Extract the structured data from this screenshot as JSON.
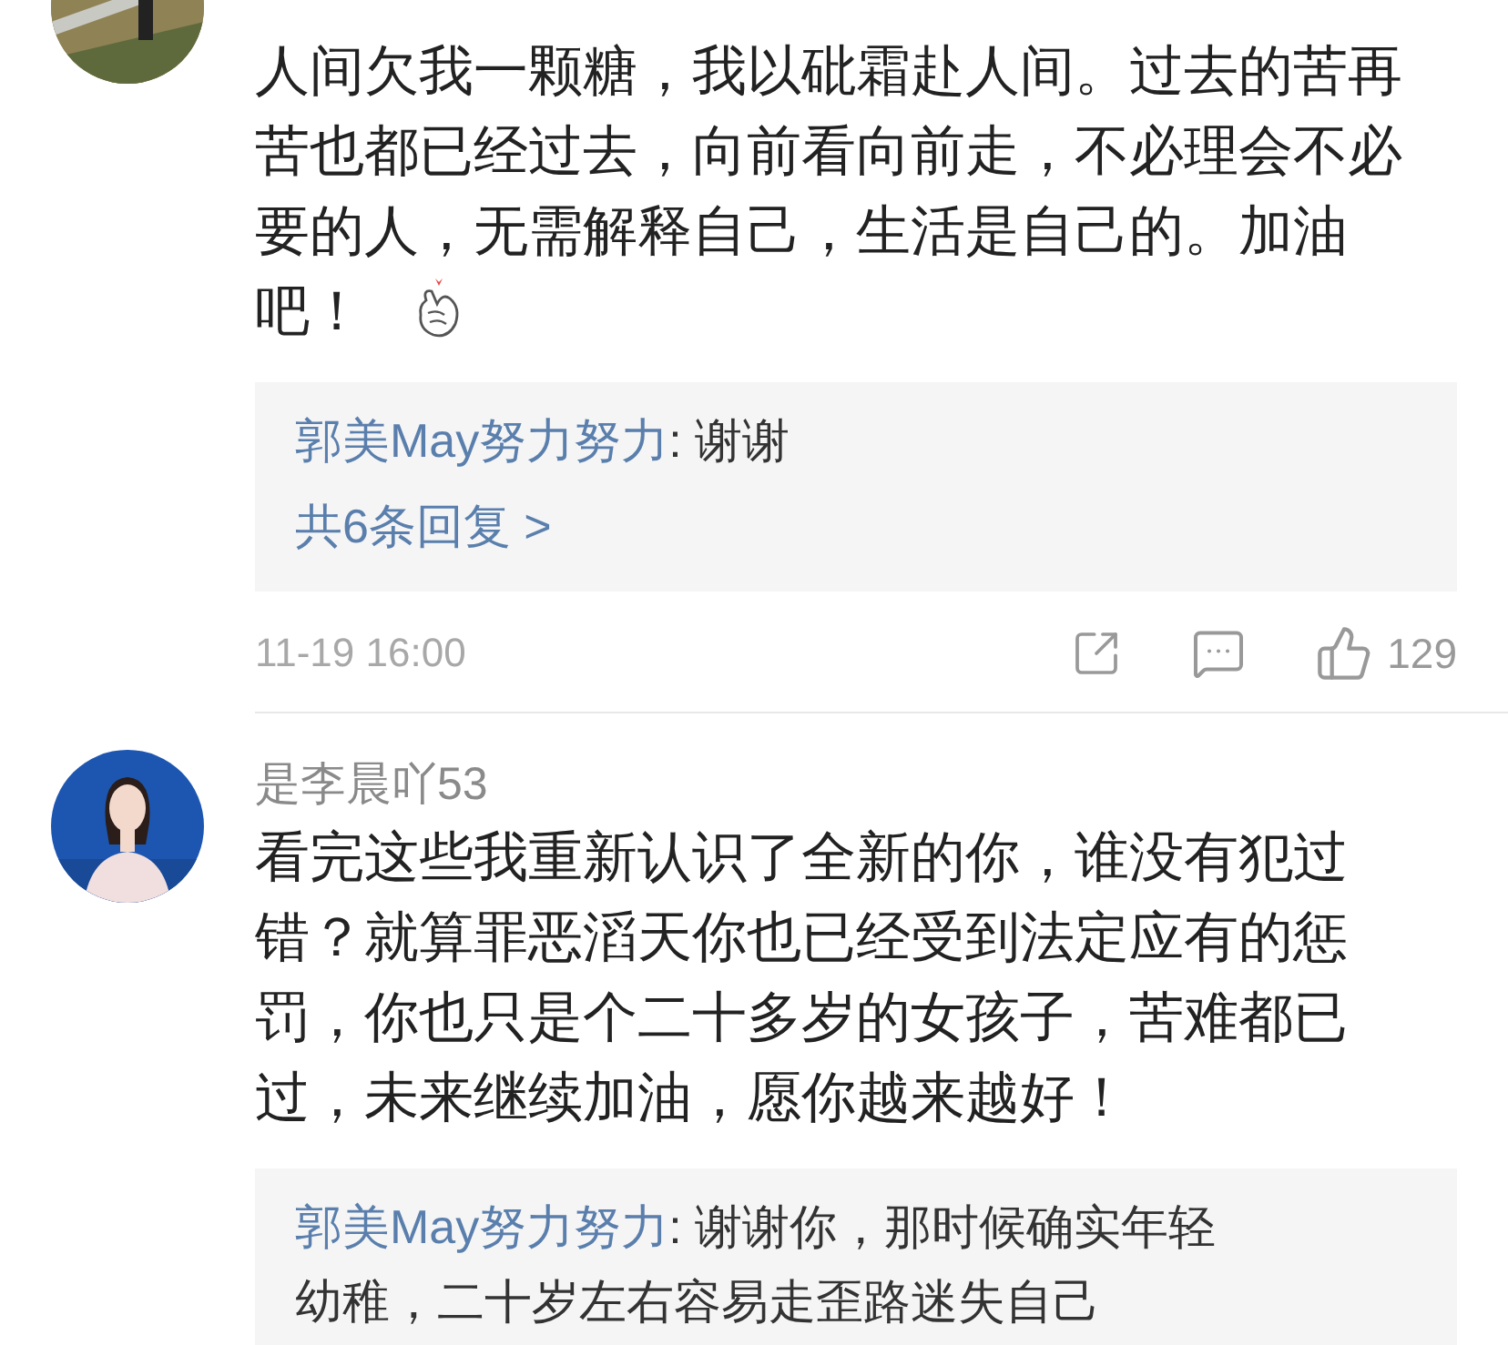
{
  "comments": [
    {
      "avatar": {
        "kind": "picture"
      },
      "text": "人间欠我一颗糖，我以砒霜赴人间。过去的苦再苦也都已经过去，向前看向前走，不必理会不必要的人，无需解释自己，生活是自己的。加油吧！",
      "emoji": true,
      "replies": [
        {
          "author": "郭美May努力努力",
          "text": ": 谢谢"
        }
      ],
      "more_replies": "共6条回复 >",
      "time": "11-19 16:00",
      "likes": "129"
    },
    {
      "avatar": {
        "kind": "picture"
      },
      "author": "是李晨吖53",
      "text": "看完这些我重新认识了全新的你，谁没有犯过错？就算罪恶滔天你也已经受到法定应有的惩罚，你也只是个二十多岁的女孩子，苦难都已过，未来继续加油，愿你越来越好！",
      "emoji": false,
      "replies": [
        {
          "author": "郭美May努力努力",
          "text": ": 谢谢你，那时候确实年轻幼稚，二十岁左右容易走歪路迷失自己"
        }
      ]
    }
  ]
}
